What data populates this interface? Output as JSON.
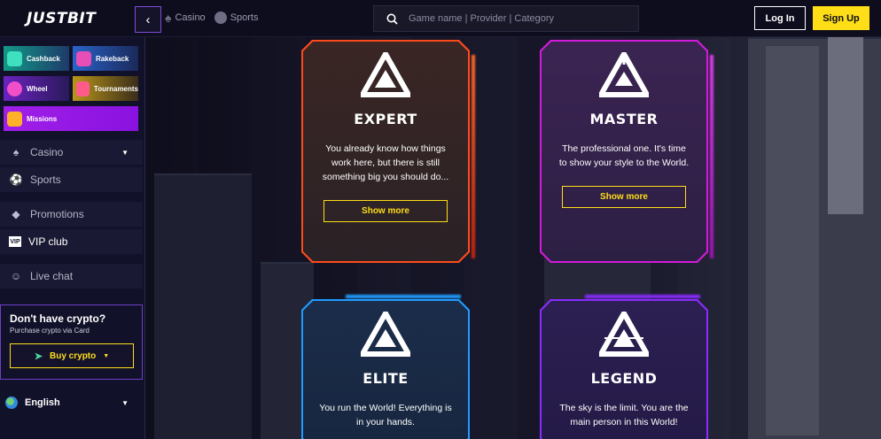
{
  "header": {
    "logo": "JUSTBIT",
    "nav": [
      {
        "label": "Casino",
        "icon": "spade-icon"
      },
      {
        "label": "Sports",
        "icon": "soccer-ball-icon"
      }
    ],
    "search_placeholder": "Game name | Provider | Category",
    "login_label": "Log In",
    "signup_label": "Sign Up"
  },
  "sidebar": {
    "promos": [
      {
        "label": "Cashback",
        "color": "#1fb59a"
      },
      {
        "label": "Rakeback",
        "color": "#2a6fd6"
      },
      {
        "label": "Wheel",
        "color": "#7b2fd6"
      },
      {
        "label": "Tournaments",
        "color": "#c9a318"
      },
      {
        "label": "Missions",
        "color": "#a020f0"
      }
    ],
    "items": [
      {
        "label": "Casino",
        "icon": "spade-icon"
      },
      {
        "label": "Sports",
        "icon": "soccer-ball-icon"
      },
      {
        "label": "Promotions",
        "icon": "tag-icon"
      },
      {
        "label": "VIP club",
        "icon": "vip-icon"
      },
      {
        "label": "Live chat",
        "icon": "support-agent-icon"
      }
    ],
    "crypto": {
      "title": "Don't have crypto?",
      "subtitle": "Purchase crypto via Card",
      "button": "Buy crypto"
    },
    "language": "English"
  },
  "cards": [
    {
      "title": "EXPERT",
      "desc": "You already know how things work here, but there is still something big you should do...",
      "button": "Show more",
      "accent": "#ff4a1c"
    },
    {
      "title": "MASTER",
      "desc": "The professional one. It's time to show your style to the World.",
      "button": "Show more",
      "accent": "#d21bd8"
    },
    {
      "title": "ELITE",
      "desc": "You run the World! Everything is in your hands.",
      "button": "",
      "accent": "#1f9cff"
    },
    {
      "title": "LEGEND",
      "desc": "The sky is the limit. You are the main person in this World!",
      "button": "",
      "accent": "#8a2bff"
    }
  ],
  "colors": {
    "accent_yellow": "#ffde17",
    "sidebar_border": "#6f3fc8"
  }
}
